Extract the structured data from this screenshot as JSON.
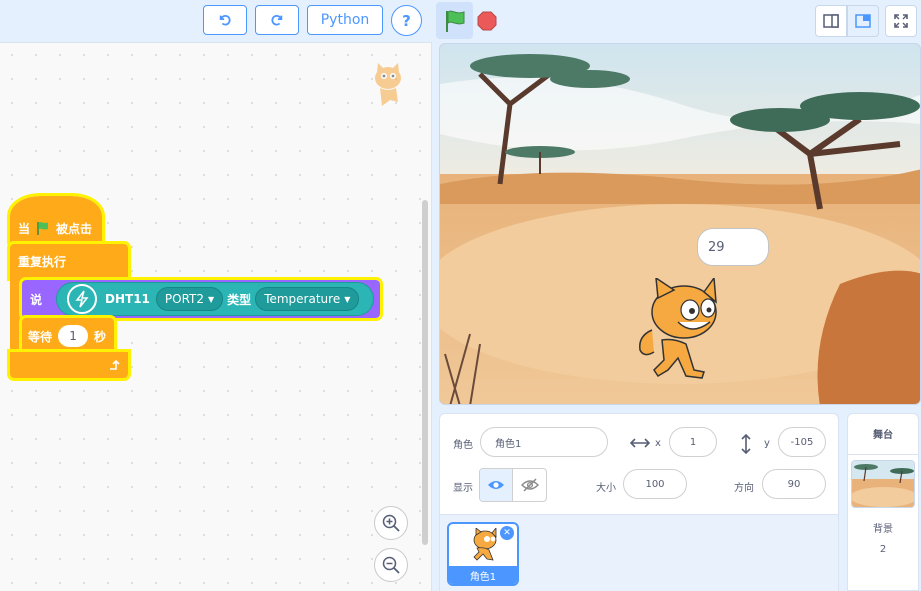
{
  "toolbar": {
    "undo_icon": "undo-icon",
    "redo_icon": "redo-icon",
    "python_label": "Python",
    "help_label": "?",
    "colors": {
      "accent": "#4c97ff",
      "flag": "#4cbf56",
      "stop": "#ec5959"
    }
  },
  "blocks": {
    "event_when": "当",
    "event_clicked": "被点击",
    "repeat_label": "重复执行",
    "say_label": "说",
    "sensor_name": "DHT11",
    "port_value": "PORT2",
    "type_label": "类型",
    "type_value": "Temperature",
    "wait_label": "等待",
    "wait_value": "1",
    "wait_unit": "秒"
  },
  "stage": {
    "bubble_text": "29"
  },
  "sprite_info": {
    "sprite_label": "角色",
    "sprite_name": "角色1",
    "x_label": "x",
    "x_value": "1",
    "y_label": "y",
    "y_value": "-105",
    "show_label": "显示",
    "size_label": "大小",
    "size_value": "100",
    "direction_label": "方向",
    "direction_value": "90"
  },
  "sprite_list": {
    "items": [
      {
        "name": "角色1"
      }
    ]
  },
  "stage_selector": {
    "header": "舞台",
    "backdrop_label": "背景",
    "backdrop_count": "2"
  }
}
